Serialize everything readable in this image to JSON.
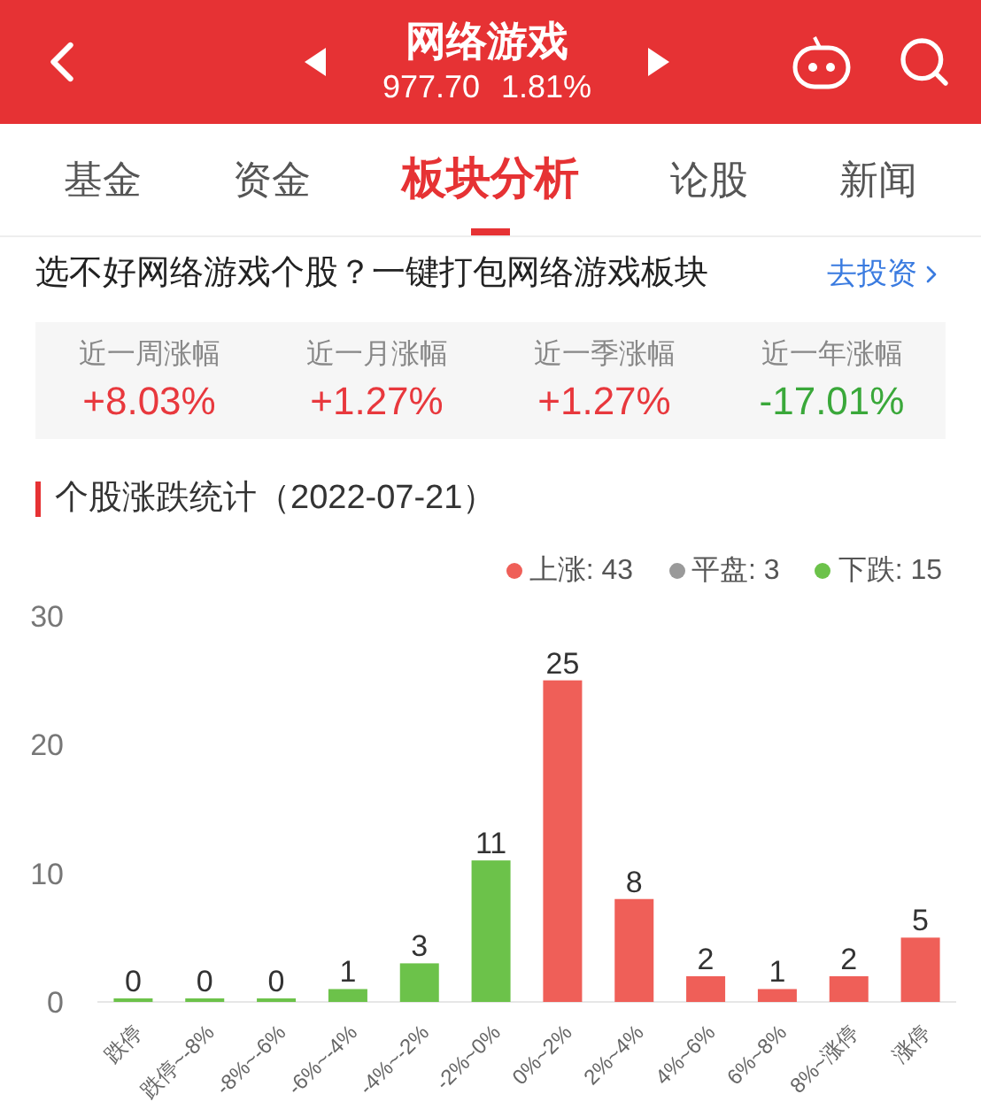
{
  "header": {
    "title": "网络游戏",
    "price": "977.70",
    "change": "1.81%"
  },
  "tabs": [
    {
      "label": "基金",
      "selected": false
    },
    {
      "label": "资金",
      "selected": false
    },
    {
      "label": "板块分析",
      "selected": true
    },
    {
      "label": "论股",
      "selected": false
    },
    {
      "label": "新闻",
      "selected": false
    }
  ],
  "promo": {
    "text": "选不好网络游戏个股？一键打包网络游戏板块",
    "link": "去投资"
  },
  "stats": [
    {
      "label": "近一周涨幅",
      "value": "+8.03%",
      "color": "#e8383d"
    },
    {
      "label": "近一月涨幅",
      "value": "+1.27%",
      "color": "#e8383d"
    },
    {
      "label": "近一季涨幅",
      "value": "+1.27%",
      "color": "#e8383d"
    },
    {
      "label": "近一年涨幅",
      "value": "-17.01%",
      "color": "#3aa83a"
    }
  ],
  "section": {
    "title": "个股涨跌统计（2022-07-21）",
    "legend": [
      {
        "label": "上涨: 43",
        "color": "#ef5f58"
      },
      {
        "label": "平盘: 3",
        "color": "#9a9a9a"
      },
      {
        "label": "下跌: 15",
        "color": "#6cc24a"
      }
    ],
    "chart_data": {
      "type": "bar",
      "categories": [
        "跌停",
        "跌停~-8%",
        "-8%~-6%",
        "-6%~-4%",
        "-4%~-2%",
        "-2%~0%",
        "0%~2%",
        "2%~4%",
        "4%~6%",
        "6%~8%",
        "8%~涨停",
        "涨停"
      ],
      "series": [
        {
          "color": "#6cc24a",
          "values": [
            0,
            0,
            0,
            1,
            3,
            11,
            null,
            null,
            null,
            null,
            null,
            null
          ]
        },
        {
          "color": "#ef5f58",
          "values": [
            null,
            null,
            null,
            null,
            null,
            null,
            25,
            8,
            2,
            1,
            2,
            5
          ]
        }
      ],
      "ylim": [
        0,
        30
      ],
      "yticks": [
        0,
        10,
        20,
        30
      ],
      "data_labels": true
    }
  }
}
